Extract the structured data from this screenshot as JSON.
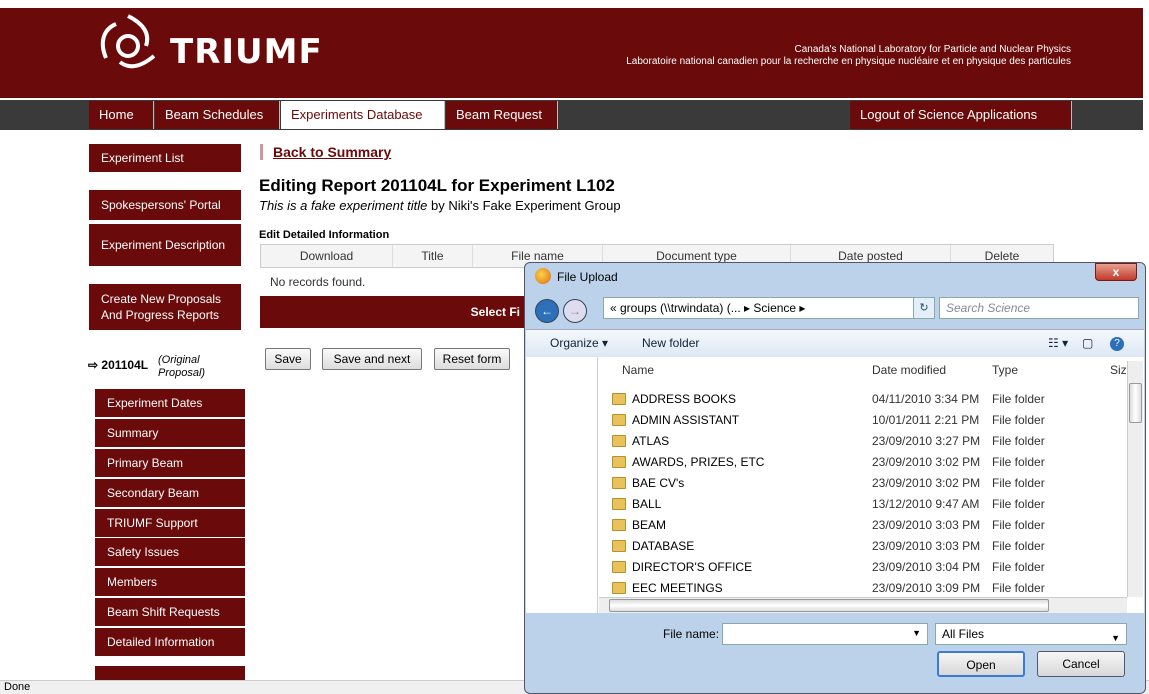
{
  "header": {
    "logo_text": "TRIUMF",
    "tagline_en": "Canada's National Laboratory for Particle and Nuclear Physics",
    "tagline_fr": "Laboratoire national canadien pour la recherche en physique nucléaire et en physique des particules"
  },
  "nav": {
    "home": "Home",
    "beam_schedules": "Beam Schedules",
    "experiments_db": "Experiments Database",
    "beam_request": "Beam Request",
    "logout": "Logout of Science Applications"
  },
  "sidebar": {
    "experiment_list": "Experiment List",
    "spokespersons": "Spokespersons' Portal",
    "description": "Experiment Description",
    "create": "Create New Proposals And Progress Reports",
    "exp_num": "201104L",
    "exp_note": "(Original Proposal)",
    "sub": [
      "Experiment Dates",
      "Summary",
      "Primary Beam",
      "Secondary Beam",
      "TRIUMF Support",
      "Safety Issues",
      "Members",
      "Beam Shift Requests",
      "Detailed Information"
    ]
  },
  "main": {
    "back": "Back to Summary",
    "title": "Editing Report 201104L for Experiment L102",
    "subtitle_italic": "This is a fake experiment title",
    "subtitle_rest": " by Niki's Fake Experiment Group",
    "section": "Edit Detailed Information",
    "columns": [
      "Download",
      "Title",
      "File name",
      "Document type",
      "Date posted",
      "Delete"
    ],
    "no_records": "No records found.",
    "select_bar": "Select Fi",
    "save": "Save",
    "save_next": "Save and next",
    "reset": "Reset form"
  },
  "dialog": {
    "title": "File Upload",
    "close": "x",
    "address": "« groups (\\\\trwindata) (... ▸ Science ▸",
    "search_placeholder": "Search Science",
    "organize": "Organize ▾",
    "new_folder": "New folder",
    "col_name": "Name",
    "col_date": "Date modified",
    "col_type": "Type",
    "col_size": "Siz",
    "files": [
      {
        "name": "ADDRESS BOOKS",
        "date": "04/11/2010 3:34 PM",
        "type": "File folder"
      },
      {
        "name": "ADMIN ASSISTANT",
        "date": "10/01/2011 2:21 PM",
        "type": "File folder"
      },
      {
        "name": "ATLAS",
        "date": "23/09/2010 3:27 PM",
        "type": "File folder"
      },
      {
        "name": "AWARDS, PRIZES, ETC",
        "date": "23/09/2010 3:02 PM",
        "type": "File folder"
      },
      {
        "name": "BAE CV's",
        "date": "23/09/2010 3:02 PM",
        "type": "File folder"
      },
      {
        "name": "BALL",
        "date": "13/12/2010 9:47 AM",
        "type": "File folder"
      },
      {
        "name": "BEAM",
        "date": "23/09/2010 3:03 PM",
        "type": "File folder"
      },
      {
        "name": "DATABASE",
        "date": "23/09/2010 3:03 PM",
        "type": "File folder"
      },
      {
        "name": "DIRECTOR'S OFFICE",
        "date": "23/09/2010 3:04 PM",
        "type": "File folder"
      },
      {
        "name": "EEC MEETINGS",
        "date": "23/09/2010 3:09 PM",
        "type": "File folder"
      }
    ],
    "file_name_label": "File name:",
    "file_type": "All Files",
    "open": "Open",
    "cancel": "Cancel"
  },
  "status": "Done"
}
